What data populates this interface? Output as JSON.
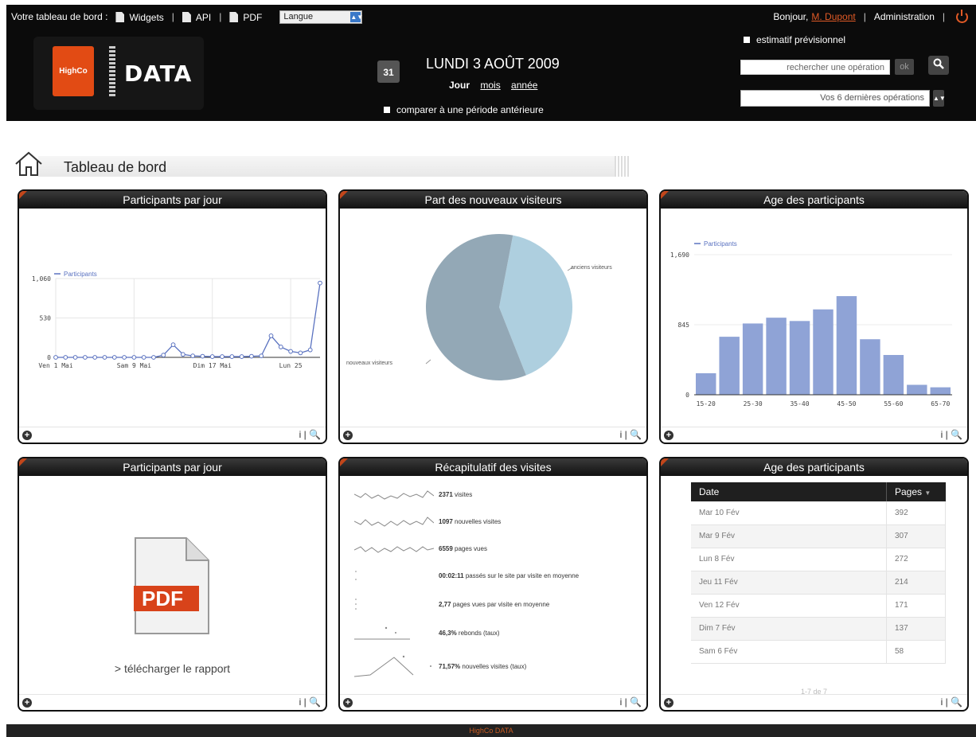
{
  "topbar": {
    "dashboard_label": "Votre tableau de bord :",
    "links": [
      "Widgets",
      "API",
      "PDF"
    ],
    "language": "Langue",
    "greeting": "Bonjour,",
    "user": "M. Dupont",
    "admin": "Administration",
    "sep": "|"
  },
  "header": {
    "logo_brand": "HighCo",
    "logo_text": "DATA",
    "calendar_icon_text": "31",
    "date": "LUNDI 3 AOÛT 2009",
    "periods": {
      "day": "Jour",
      "month": "mois",
      "year": "année"
    },
    "compare": "comparer à une période antérieure",
    "estimate": "estimatif prévisionnel",
    "search_placeholder": "rechercher une opération",
    "ok": "ok",
    "ops_select": "Vos 6 dernières opérations"
  },
  "breadcrumb": {
    "title": "Tableau de bord"
  },
  "panels": {
    "p1_title": "Participants par jour",
    "p2_title": "Part des nouveaux visiteurs",
    "p3_title": "Age des participants",
    "p4_title": "Participants par jour",
    "p5_title": "Récapitulatif des visites",
    "p6_title": "Age des participants"
  },
  "chart_data": [
    {
      "type": "line",
      "series": [
        {
          "name": "Participants",
          "values": [
            0,
            0,
            0,
            0,
            0,
            0,
            0,
            0,
            0,
            0,
            0,
            30,
            170,
            40,
            20,
            15,
            10,
            10,
            10,
            10,
            15,
            20,
            290,
            140,
            80,
            60,
            100,
            1000
          ]
        }
      ],
      "x_tick_labels": [
        "Ven 1 Mai",
        "Sam 9 Mai",
        "Dim 17 Mai",
        "Lun 25"
      ],
      "y_ticks": [
        "0",
        "530",
        "1,060"
      ],
      "ylim": [
        0,
        1060
      ]
    },
    {
      "type": "pie",
      "slices": [
        {
          "label": "anciens visiteurs",
          "value": 41,
          "color": "#aecfdf"
        },
        {
          "label": "nouveaux visiteurs",
          "value": 59,
          "color": "#93a8b6"
        }
      ]
    },
    {
      "type": "bar",
      "series": [
        {
          "name": "Participants",
          "values": [
            260,
            700,
            860,
            930,
            890,
            1030,
            1190,
            670,
            480,
            120,
            90
          ]
        }
      ],
      "x_tick_labels": [
        "15-20",
        "25-30",
        "35-40",
        "45-50",
        "55-60",
        "65-70"
      ],
      "y_ticks": [
        "0",
        "845",
        "1,690"
      ],
      "ylim": [
        0,
        1690
      ],
      "color": "#8fa3d6"
    }
  ],
  "recap": {
    "rows": [
      {
        "value": "2371",
        "label": "visites"
      },
      {
        "value": "1097",
        "label": "nouvelles visites"
      },
      {
        "value": "6559",
        "label": "pages vues"
      },
      {
        "value": "00:02:11",
        "label": "passés sur le site par visite en moyenne"
      },
      {
        "value": "2,77",
        "label": "pages vues par visite en moyenne"
      },
      {
        "value": "46,3%",
        "label": "rebonds (taux)"
      },
      {
        "value": "71,57%",
        "label": "nouvelles visites (taux)"
      }
    ]
  },
  "pdf": {
    "label": "PDF",
    "download": "> télécharger le rapport"
  },
  "table": {
    "headers": [
      "Date",
      "Pages"
    ],
    "rows": [
      [
        "Mar 10 Fév",
        "392"
      ],
      [
        "Mar 9 Fév",
        "307"
      ],
      [
        "Lun 8 Fév",
        "272"
      ],
      [
        "Jeu 11 Fév",
        "214"
      ],
      [
        "Ven 12 Fév",
        "171"
      ],
      [
        "Dim 7 Fév",
        "137"
      ],
      [
        "Sam 6 Fév",
        "58"
      ]
    ],
    "pager": "1-7 de 7"
  },
  "footer": "HighCo DATA",
  "icons": {
    "plus": "+",
    "info": "i",
    "zoom": "🔍"
  }
}
